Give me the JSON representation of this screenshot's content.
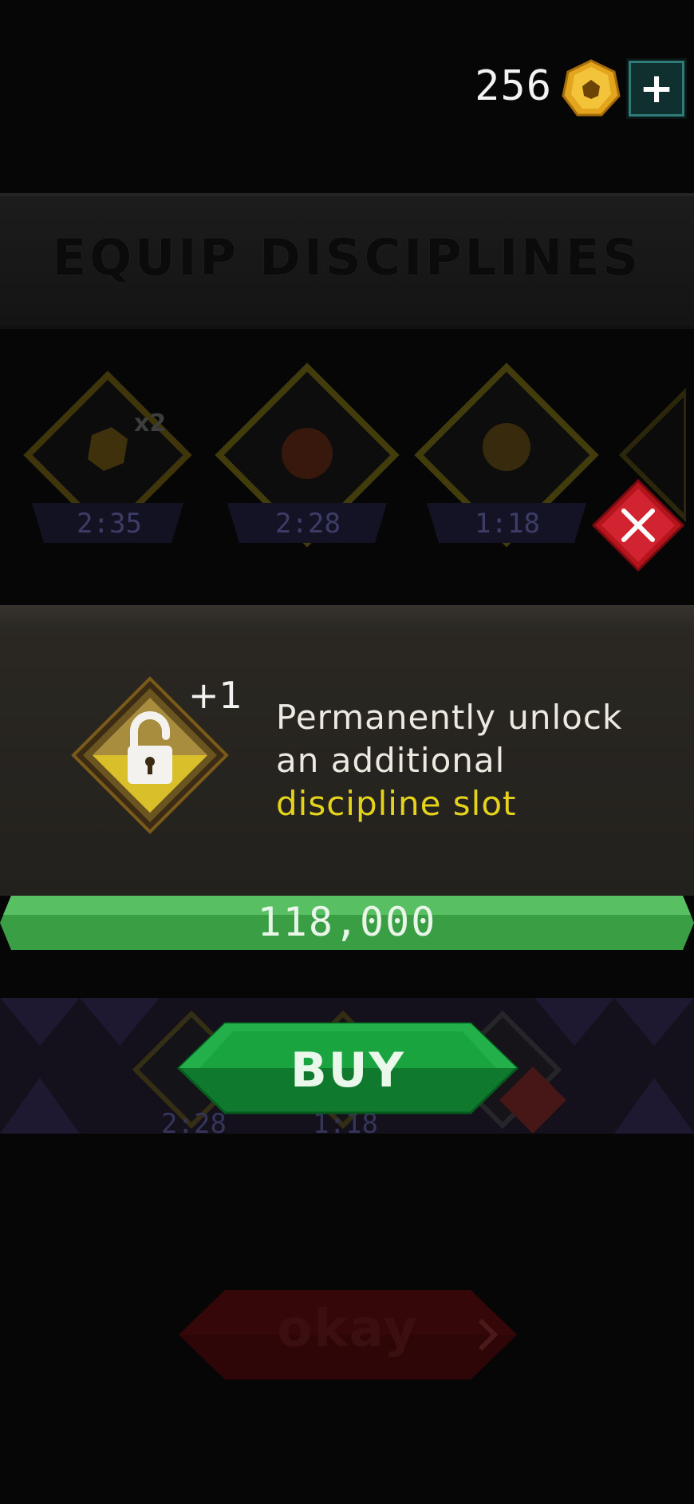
{
  "currency": {
    "amount": "256",
    "icon": "gear-coin-icon",
    "add_icon": "plus-icon"
  },
  "background": {
    "title": "EQUIP DISCIPLINES",
    "slots": [
      {
        "timer": "2:35",
        "badge": "x2"
      },
      {
        "timer": "2:28"
      },
      {
        "timer": "1:18"
      }
    ],
    "lower_slots": [
      {
        "timer": "2:28"
      },
      {
        "timer": "1:18"
      }
    ],
    "okay_label": "okay"
  },
  "dialog": {
    "bonus": "+1",
    "line1": "Permanently unlock",
    "line2": "an additional",
    "line3": "discipline slot",
    "price": "118,000",
    "buy_label": "BUY",
    "highlight_color": "#e4d21c",
    "accent_green": "#3fae48"
  }
}
